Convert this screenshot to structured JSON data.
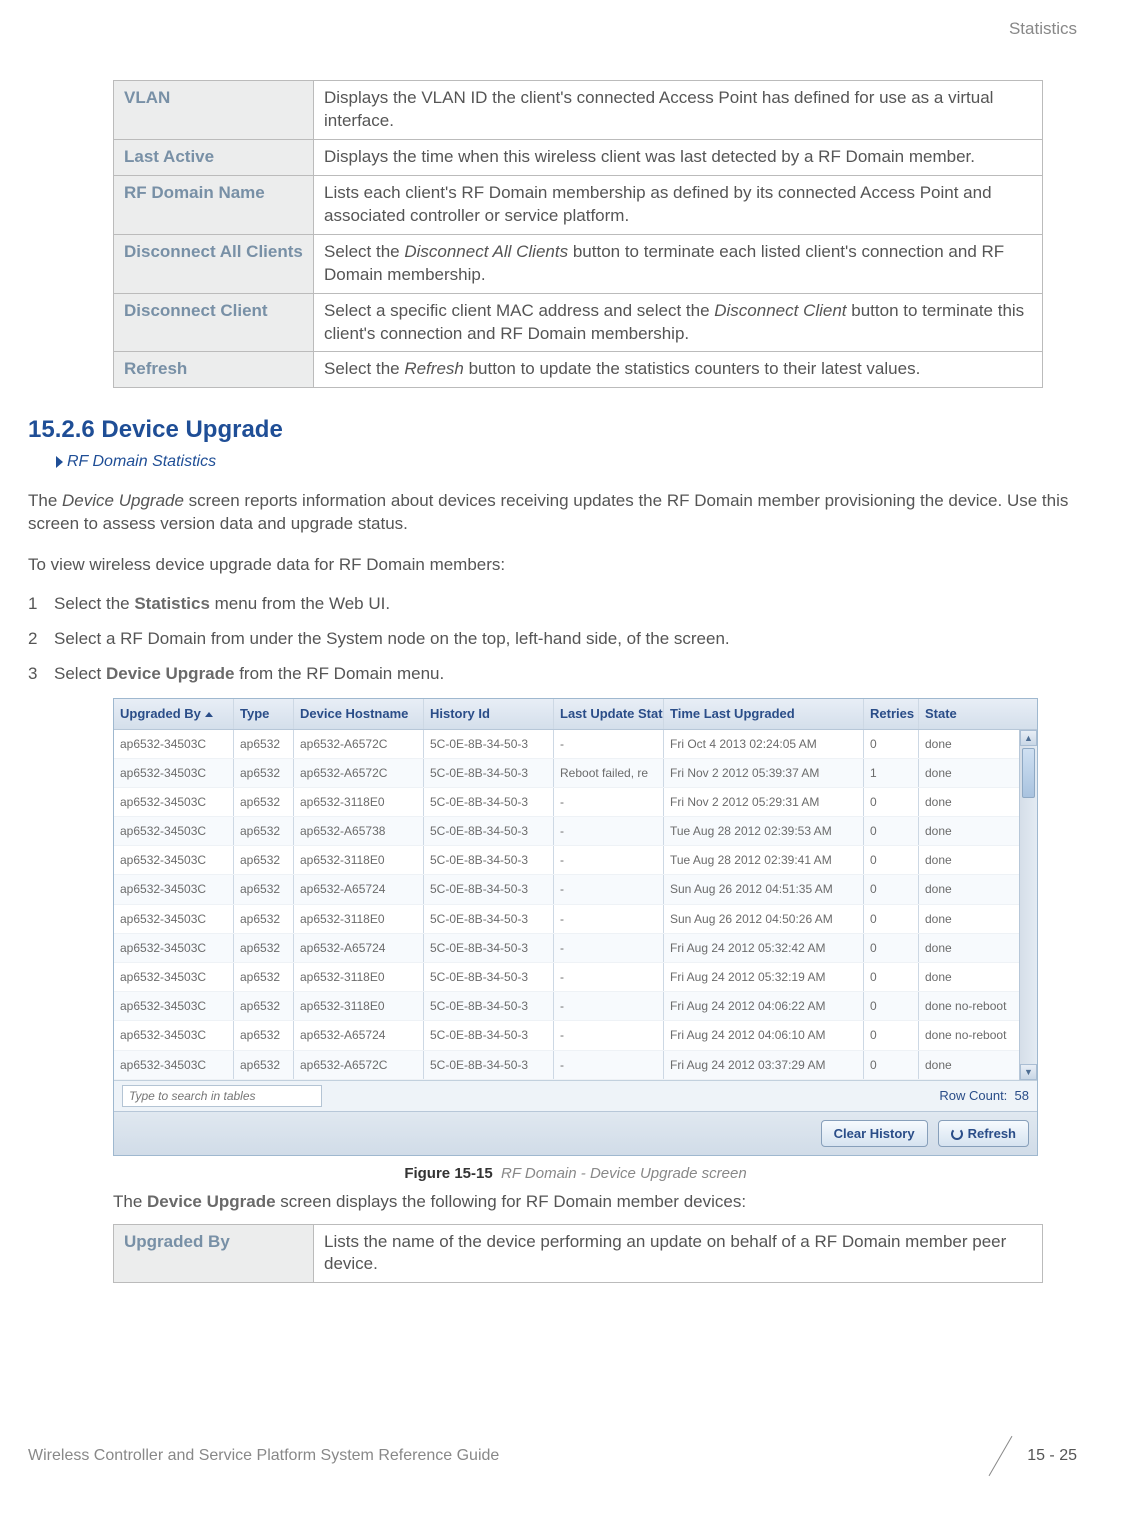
{
  "header": {
    "title": "Statistics"
  },
  "defs_top": [
    {
      "term": "VLAN",
      "desc": "Displays the VLAN ID the client's connected Access Point has defined for use as a virtual interface."
    },
    {
      "term": "Last Active",
      "desc": "Displays the time when this wireless client was last detected by a RF Domain member."
    },
    {
      "term": "RF Domain Name",
      "desc": "Lists each client's RF Domain membership as defined by its connected Access Point and associated controller or service platform."
    },
    {
      "term": "Disconnect All Clients",
      "desc_pre": "Select the ",
      "desc_em": "Disconnect All Clients",
      "desc_post": " button to terminate each listed client's connection and RF Domain membership."
    },
    {
      "term": "Disconnect Client",
      "desc_pre": "Select a specific client MAC address and select the ",
      "desc_em": "Disconnect Client",
      "desc_post": " button to terminate this client's connection and RF Domain membership."
    },
    {
      "term": "Refresh",
      "desc_pre": "Select the ",
      "desc_em": "Refresh",
      "desc_post": " button to update the statistics counters to their latest values."
    }
  ],
  "section": {
    "number": "15.2.6",
    "title": "Device Upgrade",
    "breadcrumb": "RF Domain Statistics"
  },
  "intro_p1_pre": "The ",
  "intro_p1_em": "Device Upgrade",
  "intro_p1_post": " screen reports information about devices receiving updates the RF Domain member provisioning the device. Use this screen to assess version data and upgrade status.",
  "intro_p2": "To view wireless device upgrade data for RF Domain members:",
  "steps": [
    {
      "pre": "Select the ",
      "bold": "Statistics",
      "post": " menu from the Web UI."
    },
    {
      "pre": "Select a RF Domain from under the System node on the top, left-hand side, of the screen.",
      "bold": "",
      "post": ""
    },
    {
      "pre": "Select ",
      "bold": "Device Upgrade",
      "post": " from the RF Domain menu."
    }
  ],
  "screenshot": {
    "columns": {
      "upgraded_by": "Upgraded By",
      "type": "Type",
      "device_hostname": "Device Hostname",
      "history_id": "History Id",
      "last_update_status": "Last Update Status",
      "time_last_upgraded": "Time Last Upgraded",
      "retries_count": "Retries Count",
      "state": "State"
    },
    "rows": [
      {
        "ub": "ap6532-34503C",
        "ty": "ap6532",
        "dh": "ap6532-A6572C",
        "hi": "5C-0E-8B-34-50-3",
        "lus": "-",
        "tlu": "Fri Oct 4 2013 02:24:05 AM",
        "rc": "0",
        "st": "done"
      },
      {
        "ub": "ap6532-34503C",
        "ty": "ap6532",
        "dh": "ap6532-A6572C",
        "hi": "5C-0E-8B-34-50-3",
        "lus": "Reboot failed, re",
        "tlu": "Fri Nov 2 2012 05:39:37 AM",
        "rc": "1",
        "st": "done"
      },
      {
        "ub": "ap6532-34503C",
        "ty": "ap6532",
        "dh": "ap6532-3118E0",
        "hi": "5C-0E-8B-34-50-3",
        "lus": "-",
        "tlu": "Fri Nov 2 2012 05:29:31 AM",
        "rc": "0",
        "st": "done"
      },
      {
        "ub": "ap6532-34503C",
        "ty": "ap6532",
        "dh": "ap6532-A65738",
        "hi": "5C-0E-8B-34-50-3",
        "lus": "-",
        "tlu": "Tue Aug 28 2012 02:39:53 AM",
        "rc": "0",
        "st": "done"
      },
      {
        "ub": "ap6532-34503C",
        "ty": "ap6532",
        "dh": "ap6532-3118E0",
        "hi": "5C-0E-8B-34-50-3",
        "lus": "-",
        "tlu": "Tue Aug 28 2012 02:39:41 AM",
        "rc": "0",
        "st": "done"
      },
      {
        "ub": "ap6532-34503C",
        "ty": "ap6532",
        "dh": "ap6532-A65724",
        "hi": "5C-0E-8B-34-50-3",
        "lus": "-",
        "tlu": "Sun Aug 26 2012 04:51:35 AM",
        "rc": "0",
        "st": "done"
      },
      {
        "ub": "ap6532-34503C",
        "ty": "ap6532",
        "dh": "ap6532-3118E0",
        "hi": "5C-0E-8B-34-50-3",
        "lus": "-",
        "tlu": "Sun Aug 26 2012 04:50:26 AM",
        "rc": "0",
        "st": "done"
      },
      {
        "ub": "ap6532-34503C",
        "ty": "ap6532",
        "dh": "ap6532-A65724",
        "hi": "5C-0E-8B-34-50-3",
        "lus": "-",
        "tlu": "Fri Aug 24 2012 05:32:42 AM",
        "rc": "0",
        "st": "done"
      },
      {
        "ub": "ap6532-34503C",
        "ty": "ap6532",
        "dh": "ap6532-3118E0",
        "hi": "5C-0E-8B-34-50-3",
        "lus": "-",
        "tlu": "Fri Aug 24 2012 05:32:19 AM",
        "rc": "0",
        "st": "done"
      },
      {
        "ub": "ap6532-34503C",
        "ty": "ap6532",
        "dh": "ap6532-3118E0",
        "hi": "5C-0E-8B-34-50-3",
        "lus": "-",
        "tlu": "Fri Aug 24 2012 04:06:22 AM",
        "rc": "0",
        "st": "done no-reboot"
      },
      {
        "ub": "ap6532-34503C",
        "ty": "ap6532",
        "dh": "ap6532-A65724",
        "hi": "5C-0E-8B-34-50-3",
        "lus": "-",
        "tlu": "Fri Aug 24 2012 04:06:10 AM",
        "rc": "0",
        "st": "done no-reboot"
      },
      {
        "ub": "ap6532-34503C",
        "ty": "ap6532",
        "dh": "ap6532-A6572C",
        "hi": "5C-0E-8B-34-50-3",
        "lus": "-",
        "tlu": "Fri Aug 24 2012 03:37:29 AM",
        "rc": "0",
        "st": "done"
      }
    ],
    "search_placeholder": "Type to search in tables",
    "row_count_label": "Row Count:",
    "row_count_value": "58",
    "buttons": {
      "clear_history": "Clear History",
      "refresh": "Refresh"
    }
  },
  "figure": {
    "label": "Figure 15-15",
    "caption": "RF Domain - Device Upgrade screen"
  },
  "after_fig_pre": "The ",
  "after_fig_bold": "Device Upgrade",
  "after_fig_post": " screen displays the following for RF Domain member devices:",
  "defs_bottom": [
    {
      "term": "Upgraded By",
      "desc": "Lists the name of the device performing an update on behalf of a RF Domain member peer device."
    }
  ],
  "footer": {
    "guide": "Wireless Controller and Service Platform System Reference Guide",
    "page": "15 - 25"
  }
}
